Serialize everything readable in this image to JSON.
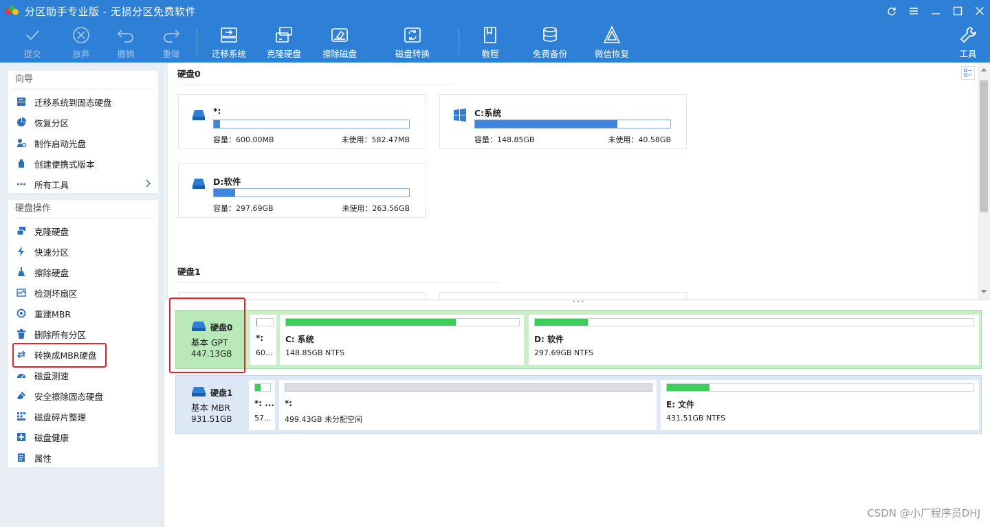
{
  "window": {
    "title": "分区助手专业版 - 无损分区免费软件"
  },
  "toolbar": {
    "items": [
      {
        "label": "提交",
        "icon": "check-icon",
        "enabled": false
      },
      {
        "label": "放弃",
        "icon": "discard-icon",
        "enabled": false
      },
      {
        "label": "撤销",
        "icon": "undo-icon",
        "enabled": false
      },
      {
        "label": "重做",
        "icon": "redo-icon",
        "enabled": false
      },
      {
        "label": "迁移系统",
        "icon": "migrate-os-icon",
        "enabled": true
      },
      {
        "label": "克隆硬盘",
        "icon": "clone-disk-icon",
        "enabled": true
      },
      {
        "label": "擦除磁盘",
        "icon": "wipe-disk-icon",
        "enabled": true
      },
      {
        "label": "磁盘转换",
        "icon": "disk-convert-icon",
        "enabled": true
      },
      {
        "label": "教程",
        "icon": "tutorial-book-icon",
        "enabled": true
      },
      {
        "label": "免费备份",
        "icon": "free-backup-icon",
        "enabled": true
      },
      {
        "label": "微信恢复",
        "icon": "wechat-recovery-icon",
        "enabled": true
      },
      {
        "label": "工具",
        "icon": "tools-wrench-icon",
        "enabled": true
      }
    ]
  },
  "sidebar": {
    "wizard": {
      "title": "向导",
      "items": [
        {
          "label": "迁移系统到固态硬盘",
          "icon": "migrate-ssd-icon"
        },
        {
          "label": "恢复分区",
          "icon": "recover-partition-icon"
        },
        {
          "label": "制作启动光盘",
          "icon": "boot-disc-icon"
        },
        {
          "label": "创建便携式版本",
          "icon": "portable-version-icon"
        },
        {
          "label": "所有工具",
          "icon": "more-tools-icon",
          "has_arrow": true
        }
      ]
    },
    "disk_ops": {
      "title": "硬盘操作",
      "items": [
        {
          "label": "克隆硬盘",
          "icon": "clone-disk-icon"
        },
        {
          "label": "快速分区",
          "icon": "quick-partition-icon"
        },
        {
          "label": "擦除硬盘",
          "icon": "wipe-disk-icon"
        },
        {
          "label": "检测坏扇区",
          "icon": "bad-sector-icon"
        },
        {
          "label": "重建MBR",
          "icon": "rebuild-mbr-icon"
        },
        {
          "label": "删除所有分区",
          "icon": "delete-partitions-icon"
        },
        {
          "label": "转换成MBR硬盘",
          "icon": "convert-mbr-icon",
          "highlighted": true
        },
        {
          "label": "磁盘测速",
          "icon": "disk-speed-icon"
        },
        {
          "label": "安全擦除固态硬盘",
          "icon": "secure-erase-ssd-icon"
        },
        {
          "label": "磁盘碎片整理",
          "icon": "defrag-icon"
        },
        {
          "label": "磁盘健康",
          "icon": "disk-health-icon"
        },
        {
          "label": "属性",
          "icon": "properties-icon"
        }
      ]
    }
  },
  "partition_view": {
    "disk0": {
      "title": "硬盘0",
      "partitions": [
        {
          "name": "*:",
          "capacity_label": "容量：600.00MB",
          "free_label": "未使用：582.47MB",
          "used_fraction": 0.03,
          "icon": "drive-icon"
        },
        {
          "name": "C:系统",
          "capacity_label": "容量：148.85GB",
          "free_label": "未使用：40.58GB",
          "used_fraction": 0.73,
          "icon": "windows-icon"
        },
        {
          "name": "D:软件",
          "capacity_label": "容量：297.69GB",
          "free_label": "未使用：263.56GB",
          "used_fraction": 0.11,
          "icon": "drive-icon"
        }
      ]
    },
    "disk1": {
      "title": "硬盘1"
    }
  },
  "disk_map": {
    "disks": [
      {
        "name": "硬盘0",
        "type": "基本 GPT",
        "size": "447.13GB",
        "selected": true,
        "partitions": [
          {
            "name": "*:",
            "detail": "60...",
            "used_fraction": 0.03,
            "unallocated": false
          },
          {
            "name": "C: 系统",
            "detail": "148.85GB NTFS",
            "used_fraction": 0.73,
            "unallocated": false
          },
          {
            "name": "D: 软件",
            "detail": "297.69GB NTFS",
            "used_fraction": 0.12,
            "unallocated": false
          }
        ]
      },
      {
        "name": "硬盘1",
        "type": "基本 MBR",
        "size": "931.51GB",
        "selected": false,
        "partitions": [
          {
            "name": "*: ...",
            "detail": "57...",
            "used_fraction": 0.35,
            "unallocated": false
          },
          {
            "name": "*:",
            "detail": "499.43GB 未分配空间",
            "used_fraction": 0,
            "unallocated": true
          },
          {
            "name": "E: 文件",
            "detail": "431.51GB NTFS",
            "used_fraction": 0.14,
            "unallocated": false
          }
        ]
      }
    ]
  },
  "watermark": "CSDN @小厂程序员DHJ",
  "colors": {
    "titlebar": "#2e7fd6",
    "usage_bar_top": "#3c86e0",
    "usage_bar_map": "#3ccd5a",
    "selected_disk": "#c9efc9",
    "highlight_box": "#e0242b"
  }
}
